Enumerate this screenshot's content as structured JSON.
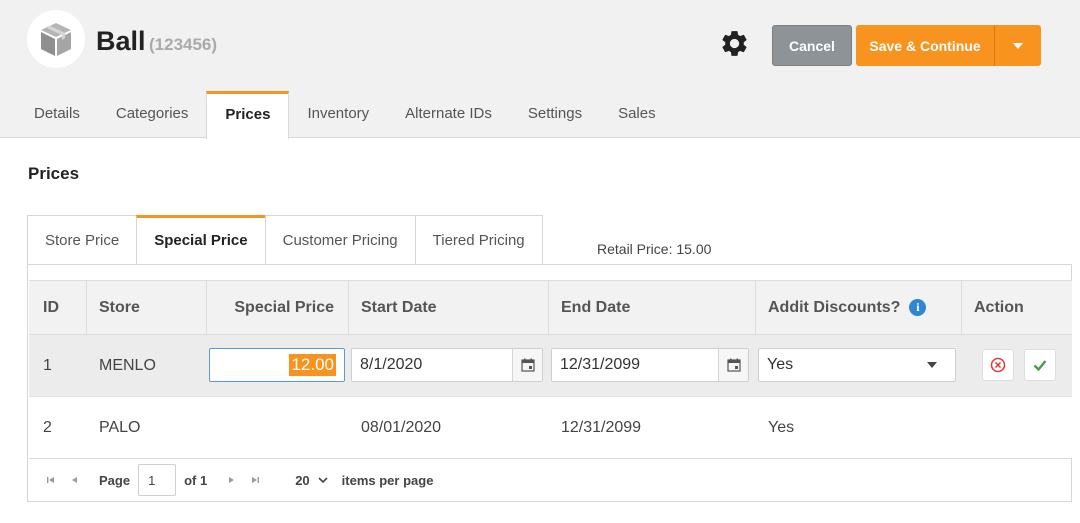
{
  "header": {
    "title": "Ball",
    "subtitle": "(123456)",
    "icons": {
      "logo": "box-icon",
      "settings": "gear-icon"
    },
    "cancel_label": "Cancel",
    "save_label": "Save & Continue"
  },
  "main_tabs": [
    "Details",
    "Categories",
    "Prices",
    "Inventory",
    "Alternate IDs",
    "Settings",
    "Sales"
  ],
  "main_tab_active": "Prices",
  "section_title": "Prices",
  "sub_tabs": [
    "Store Price",
    "Special Price",
    "Customer Pricing",
    "Tiered Pricing"
  ],
  "sub_tab_active": "Special Price",
  "retail_price": "Retail Price: 15.00",
  "table": {
    "columns": [
      "ID",
      "Store",
      "Special Price",
      "Start Date",
      "End Date",
      "Addit Discounts?",
      "Action"
    ],
    "rows": [
      {
        "id": "1",
        "store": "MENLO",
        "special_price": "12.00",
        "start_date": "8/1/2020",
        "end_date": "12/31/2099",
        "addit_discounts": "Yes"
      },
      {
        "id": "2",
        "store": "PALO",
        "special_price": "",
        "start_date": "08/01/2020",
        "end_date": "12/31/2099",
        "addit_discounts": "Yes"
      }
    ]
  },
  "pager": {
    "page_label": "Page",
    "page_value": "1",
    "of_label": "of 1",
    "page_size": "20",
    "items_label": "items per page"
  },
  "colors": {
    "accent": "#f7931e",
    "cancel": "#8e9398",
    "info": "#2f86d6",
    "delete": "#e53935",
    "confirm": "#43a047"
  }
}
